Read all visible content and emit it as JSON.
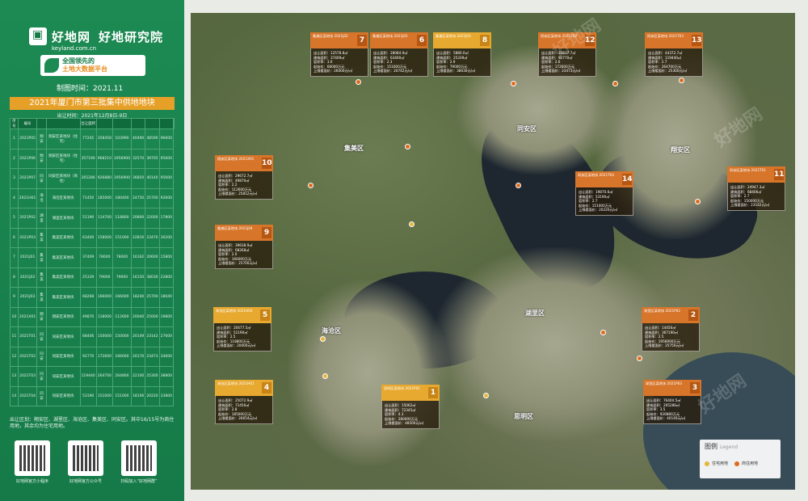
{
  "brand": {
    "name": "好地网",
    "institute": "好地研究院",
    "url": "keyland.com.cn",
    "platform_line1": "全国领先的",
    "platform_line2": "土地大数据平台"
  },
  "draw_time": "制图时间：2021.11",
  "table": {
    "title": "2021年厦门市第三批集中供地地块",
    "subtitle": "出让时间：2021年12月8日-9日",
    "headers": [
      "序号",
      "编号",
      "",
      "",
      "出让面积",
      "",
      "",
      "",
      "",
      "",
      ""
    ],
    "rows": [
      {
        "no": "1",
        "code": "2021P05",
        "district": "翔安",
        "desc": "翔安区某地块（住宅）",
        "area": "77245",
        "v1": "358458",
        "v2": "103990",
        "v3": "40490",
        "v4": "48590",
        "v5": "96600"
      },
      {
        "no": "2",
        "code": "2021P06",
        "district": "翔安",
        "desc": "翔安区某地块（住宅）",
        "area": "357190",
        "v1": "968210",
        "v2": "1956900",
        "v3": "32570",
        "v4": "39705",
        "v5": "95600"
      },
      {
        "no": "3",
        "code": "2021P07",
        "district": "同安",
        "desc": "同安区某地块（商住）",
        "area": "265286",
        "v1": "926880",
        "v2": "1956900",
        "v3": "36850",
        "v4": "40140",
        "v5": "95600"
      },
      {
        "no": "4",
        "code": "2021H01",
        "district": "海沧",
        "desc": "海沧区某地块",
        "area": "71450",
        "v1": "185000",
        "v2": "180400",
        "v3": "24750",
        "v4": "25700",
        "v5": "92600"
      },
      {
        "no": "5",
        "code": "2021P02",
        "district": "湖里",
        "desc": "湖里区某地块",
        "area": "51190",
        "v1": "114700",
        "v2": "118800",
        "v3": "20800",
        "v4": "22000",
        "v5": "17800"
      },
      {
        "no": "6",
        "code": "2021P03",
        "district": "集美",
        "desc": "集美区某地块",
        "area": "63400",
        "v1": "158000",
        "v2": "151000",
        "v3": "22810",
        "v4": "23470",
        "v5": "30200"
      },
      {
        "no": "7",
        "code": "2021J01",
        "district": "集美",
        "desc": "集美区某地块",
        "area": "37409",
        "v1": "78000",
        "v2": "78000",
        "v3": "16162",
        "v4": "20600",
        "v5": "15800"
      },
      {
        "no": "8",
        "code": "2021J02",
        "district": "集美",
        "desc": "集美区某地块",
        "area": "25339",
        "v1": "79000",
        "v2": "79000",
        "v3": "16150",
        "v4": "38030",
        "v5": "22800"
      },
      {
        "no": "9",
        "code": "2021J03",
        "district": "集美",
        "desc": "集美区某地块",
        "area": "68268",
        "v1": "166000",
        "v2": "166000",
        "v3": "18240",
        "v4": "25700",
        "v5": "18040"
      },
      {
        "no": "10",
        "code": "2021X01",
        "district": "翔安",
        "desc": "翔安区某地块",
        "area": "49870",
        "v1": "118000",
        "v2": "112600",
        "v3": "20040",
        "v4": "25000",
        "v5": "19800"
      },
      {
        "no": "11",
        "code": "2021T01",
        "district": "同安",
        "desc": "同安区某地块",
        "area": "68406",
        "v1": "150000",
        "v2": "150000",
        "v3": "20149",
        "v4": "23142",
        "v5": "27600"
      },
      {
        "no": "12",
        "code": "2021T02",
        "district": "同安",
        "desc": "同安区某地块",
        "area": "92770",
        "v1": "172600",
        "v2": "166000",
        "v3": "20170",
        "v4": "23473",
        "v5": "34600"
      },
      {
        "no": "13",
        "code": "2021T03",
        "district": "同安",
        "desc": "同安区某地块",
        "area": "119440",
        "v1": "264700",
        "v2": "264800",
        "v3": "22100",
        "v4": "25300",
        "v5": "38800"
      },
      {
        "no": "14",
        "code": "2021T04",
        "district": "同安",
        "desc": "同安区某地块",
        "area": "53190",
        "v1": "151000",
        "v2": "151000",
        "v3": "18106",
        "v4": "20220",
        "v5": "33800"
      }
    ]
  },
  "note": "出让区划：翔安区、湖里区、海沧区、集美区、同安区。其中16/15号为商住用地，其余均为住宅用地。",
  "qr": [
    {
      "label": "好地网官方小程序"
    },
    {
      "label": "好地网官方公众号"
    },
    {
      "label": "扫码加入“好地网群”"
    }
  ],
  "districts": [
    "集美区",
    "同安区",
    "翔安区",
    "湖里区",
    "海沧区",
    "思明区"
  ],
  "callouts": [
    {
      "num": "1",
      "type": "res",
      "head": "思明区某地块 2021P01",
      "l1": "出让面积：15062㎡",
      "l2": "建筑面积：72345㎡",
      "l3": "容积率：4.3",
      "l4": "起始价：280000万元",
      "l5": "上限楼面价：48500元/㎡"
    },
    {
      "num": "2",
      "type": "com",
      "head": "湖里区某地块 2021P02",
      "l1": "出让面积：14456㎡",
      "l2": "建筑面积：367190㎡",
      "l3": "容积率：2.5",
      "l4": "起始价：1956900万元",
      "l5": "上限楼面价：25750元/㎡"
    },
    {
      "num": "3",
      "type": "com",
      "head": "湖里区某地块 2021P03",
      "l1": "出让面积：76404.5㎡",
      "l2": "建筑面积：265286㎡",
      "l3": "容积率：3.5",
      "l4": "起始价：926880万元",
      "l5": "上限楼面价：40140元/㎡"
    },
    {
      "num": "4",
      "type": "res",
      "head": "海沧区某地块 2021H01",
      "l1": "出让面积：25072.9㎡",
      "l2": "建筑面积：71450㎡",
      "l3": "容积率：2.8",
      "l4": "起始价：185000万元",
      "l5": "上限楼面价：26654元/㎡"
    },
    {
      "num": "5",
      "type": "res",
      "head": "海沧区某地块 2021H02",
      "l1": "出让面积：20477.5㎡",
      "l2": "建筑面积：51190㎡",
      "l3": "容积率：2.5",
      "l4": "起始价：118800万元",
      "l5": "上限楼面价：20000元/㎡"
    },
    {
      "num": "6",
      "type": "com",
      "head": "集美区某地块 2021J01",
      "l1": "出让面积：28084.9㎡",
      "l2": "建筑面积：63400㎡",
      "l3": "容积率：2.3",
      "l4": "起始价：151000万元",
      "l5": "上限楼面价：20742元/㎡"
    },
    {
      "num": "7",
      "type": "com",
      "head": "集美区某地块 2021J02",
      "l1": "出让面积：12578.8㎡",
      "l2": "建筑面积：37409㎡",
      "l3": "容积率：3.0",
      "l4": "起始价：68000万元",
      "l5": "上限楼面价：26000元/㎡"
    },
    {
      "num": "8",
      "type": "res",
      "head": "集美区某地块 2021J03",
      "l1": "出让面积：5880.0㎡",
      "l2": "建筑面积：25339㎡",
      "l3": "容积率：2.9",
      "l4": "起始价：79000万元",
      "l5": "上限楼面价：38030元/㎡"
    },
    {
      "num": "9",
      "type": "com",
      "head": "集美区某地块 2021J04",
      "l1": "出让面积：39638.9㎡",
      "l2": "建筑面积：68268㎡",
      "l3": "容积率：2.0",
      "l4": "起始价：166000万元",
      "l5": "上限楼面价：25700元/㎡"
    },
    {
      "num": "10",
      "type": "com",
      "head": "翔安区某地块 2021X01",
      "l1": "出让面积：29672.7㎡",
      "l2": "建筑面积：49870㎡",
      "l3": "容积率：2.2",
      "l4": "起始价：112600万元",
      "l5": "上限楼面价：25812元/㎡"
    },
    {
      "num": "11",
      "type": "com",
      "head": "同安区某地块 2021T01",
      "l1": "出让面积：24947.3㎡",
      "l2": "建筑面积：68406㎡",
      "l3": "容积率：2.7",
      "l4": "起始价：150000万元",
      "l5": "上限楼面价：23142元/㎡"
    },
    {
      "num": "12",
      "type": "com",
      "head": "同安区某地块 2021T02",
      "l1": "出让面积：35837.7㎡",
      "l2": "建筑面积：92770㎡",
      "l3": "容积率：2.6",
      "l4": "起始价：172600万元",
      "l5": "上限楼面价：23473元/㎡"
    },
    {
      "num": "13",
      "type": "com",
      "head": "同安区某地块 2021T03",
      "l1": "出让面积：44372.7㎡",
      "l2": "建筑面积：119440㎡",
      "l3": "容积率：2.7",
      "l4": "起始价：264700万元",
      "l5": "上限楼面价：25300元/㎡"
    },
    {
      "num": "14",
      "type": "com",
      "head": "同安区某地块 2021T04",
      "l1": "出让面积：19870.6㎡",
      "l2": "建筑面积：53190㎡",
      "l3": "容积率：2.7",
      "l4": "起始价：151000万元",
      "l5": "上限楼面价：20220元/㎡"
    }
  ],
  "legend": {
    "title": "图例",
    "title_en": "Legend",
    "items": [
      {
        "label": "住宅用地",
        "color": "#e7b63a"
      },
      {
        "label": "商住用地",
        "color": "#e06a1c"
      }
    ]
  },
  "watermark": "好地网"
}
